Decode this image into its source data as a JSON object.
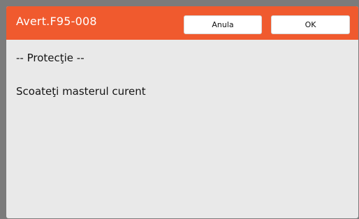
{
  "dialog": {
    "title": "Avert.F95-008",
    "cancel_label": "Anula",
    "ok_label": "OK",
    "message_heading": "-- Protecţie --",
    "message_body": "Scoateţi masterul curent"
  },
  "colors": {
    "title_bar": "#f05a2e",
    "dialog_bg": "#e9e9e9",
    "backdrop": "#7b7b7b"
  }
}
